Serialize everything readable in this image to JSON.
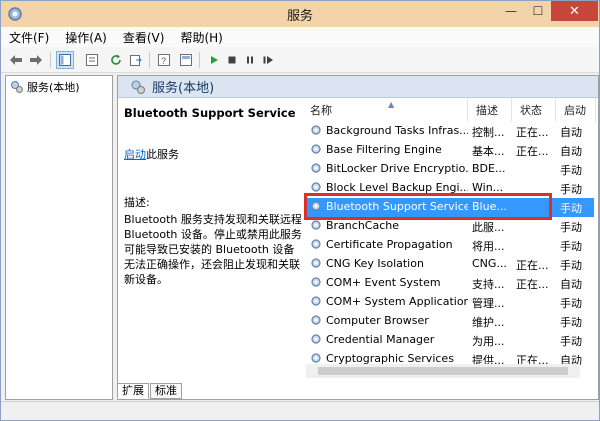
{
  "window": {
    "title": "服务",
    "minimize": "—",
    "maximize": "☐",
    "close": "✕"
  },
  "menu": [
    "文件(F)",
    "操作(A)",
    "查看(V)",
    "帮助(H)"
  ],
  "tree": {
    "root": "服务(本地)"
  },
  "main": {
    "header": "服务(本地)"
  },
  "description": {
    "service_name": "Bluetooth Support Service",
    "action_link": "启动",
    "action_suffix": "此服务",
    "label": "描述:",
    "text": "Bluetooth 服务支持发现和关联远程 Bluetooth 设备。停止或禁用此服务可能导致已安装的 Bluetooth 设备无法正确操作，还会阻止发现和关联新设备。"
  },
  "columns": [
    "名称",
    "描述",
    "状态",
    "启动"
  ],
  "services": [
    {
      "name": "Background Tasks Infras...",
      "desc": "控制...",
      "status": "正在...",
      "start": "自动"
    },
    {
      "name": "Base Filtering Engine",
      "desc": "基本...",
      "status": "正在...",
      "start": "自动"
    },
    {
      "name": "BitLocker Drive Encryptio...",
      "desc": "BDE...",
      "status": "",
      "start": "手动"
    },
    {
      "name": "Block Level Backup Engi...",
      "desc": "Win...",
      "status": "",
      "start": "手动"
    },
    {
      "name": "Bluetooth Support Service",
      "desc": "Blue...",
      "status": "",
      "start": "手动"
    },
    {
      "name": "BranchCache",
      "desc": "此服...",
      "status": "",
      "start": "手动"
    },
    {
      "name": "Certificate Propagation",
      "desc": "将用...",
      "status": "",
      "start": "手动"
    },
    {
      "name": "CNG Key Isolation",
      "desc": "CNG...",
      "status": "正在...",
      "start": "手动"
    },
    {
      "name": "COM+ Event System",
      "desc": "支持...",
      "status": "正在...",
      "start": "自动"
    },
    {
      "name": "COM+ System Application",
      "desc": "管理...",
      "status": "",
      "start": "手动"
    },
    {
      "name": "Computer Browser",
      "desc": "维护...",
      "status": "",
      "start": "手动"
    },
    {
      "name": "Credential Manager",
      "desc": "为用...",
      "status": "",
      "start": "手动"
    },
    {
      "name": "Cryptographic Services",
      "desc": "提供...",
      "status": "正在...",
      "start": "自动"
    }
  ],
  "selected_index": 4,
  "tabs": [
    "扩展",
    "标准"
  ],
  "colors": {
    "selection": "#3399ff",
    "highlight": "#d9322c",
    "titlebar": "#f3d4a9"
  }
}
